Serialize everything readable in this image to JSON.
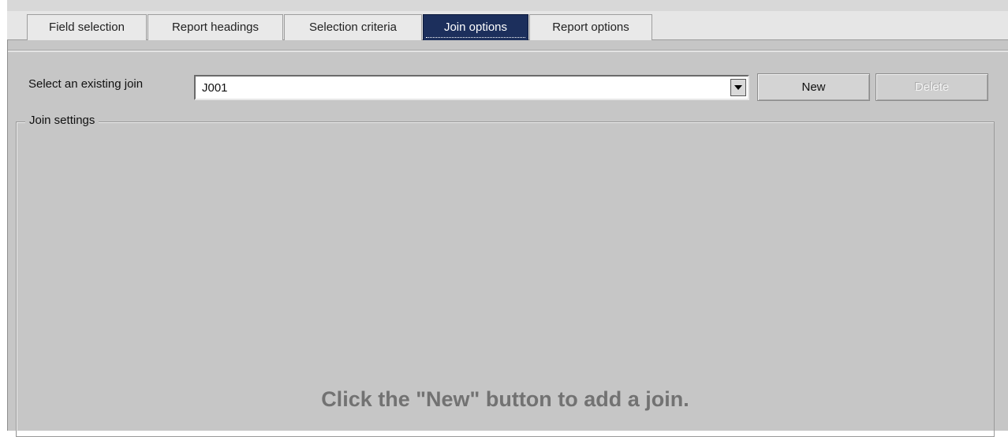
{
  "tabs": [
    {
      "label": "Field selection",
      "active": false
    },
    {
      "label": "Report headings",
      "active": false
    },
    {
      "label": "Selection criteria",
      "active": false
    },
    {
      "label": "Join options",
      "active": true
    },
    {
      "label": "Report options",
      "active": false
    }
  ],
  "join_select": {
    "label": "Select an existing join",
    "value": "J001",
    "arrow_icon": "chevron-down-icon"
  },
  "buttons": {
    "new_label": "New",
    "delete_label": "Delete"
  },
  "join_settings": {
    "legend": "Join settings",
    "hint": "Click the \"New\" button to add a join."
  },
  "colors": {
    "active_tab_bg": "#1c2f5c",
    "panel_bg": "#c6c6c6",
    "hint_text": "#727272"
  }
}
